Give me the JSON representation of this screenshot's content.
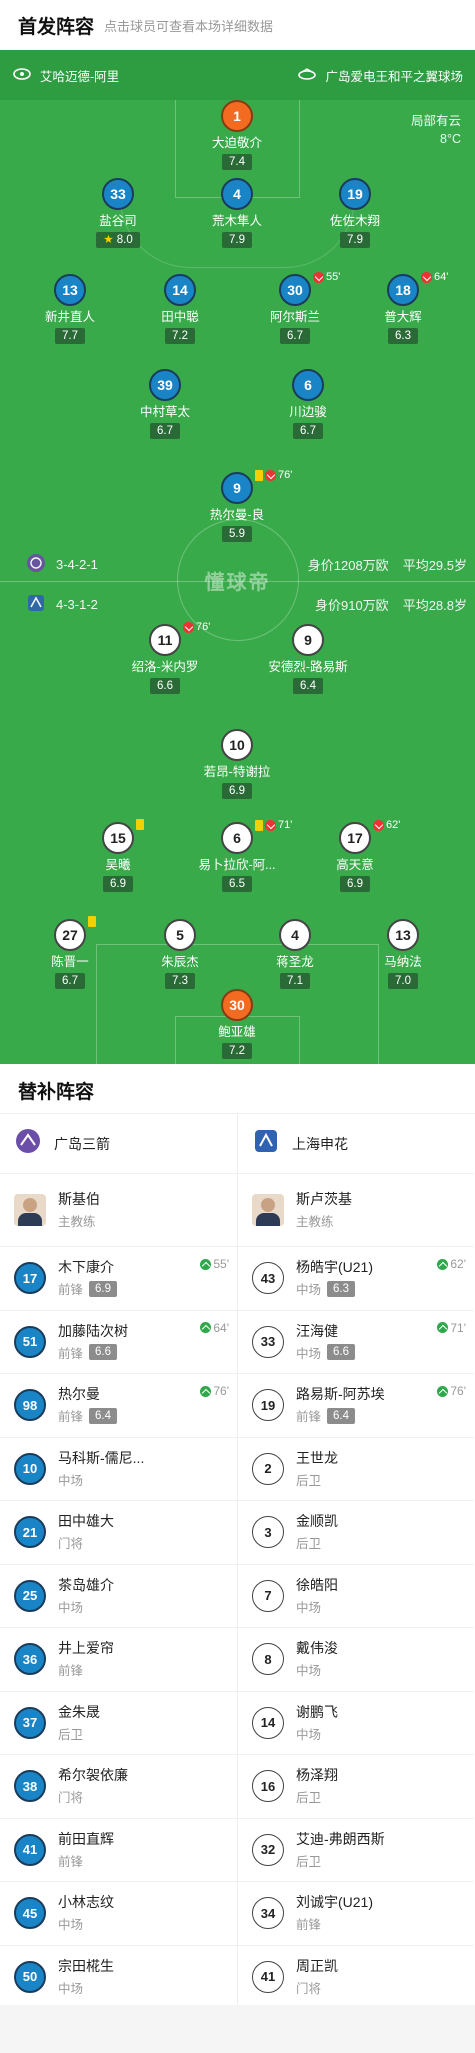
{
  "header": {
    "title": "首发阵容",
    "subtitle": "点击球员可查看本场详细数据"
  },
  "venue": {
    "city": "艾哈迈德-阿里",
    "stadium": "广岛爱电王和平之翼球场"
  },
  "weather": {
    "condition": "局部有云",
    "temp": "8°C"
  },
  "brand": "懂球帝",
  "home_team": {
    "formation": "3-4-2-1",
    "value": "身价1208万欧",
    "age": "平均29.5岁"
  },
  "away_team": {
    "formation": "4-3-1-2",
    "value": "身价910万欧",
    "age": "平均28.8岁"
  },
  "home_players": [
    {
      "num": "1",
      "name": "大迫敬介",
      "rating": "7.4",
      "kind": "gk"
    },
    {
      "num": "33",
      "name": "盐谷司",
      "rating": "8.0",
      "star": true
    },
    {
      "num": "4",
      "name": "荒木隼人",
      "rating": "7.9",
      "goal": true
    },
    {
      "num": "19",
      "name": "佐佐木翔",
      "rating": "7.9",
      "captain": true
    },
    {
      "num": "13",
      "name": "新井直人",
      "rating": "7.7",
      "assist": true
    },
    {
      "num": "14",
      "name": "田中聪",
      "rating": "7.2"
    },
    {
      "num": "30",
      "name": "阿尔斯兰",
      "rating": "6.7",
      "sub_min": "55'"
    },
    {
      "num": "18",
      "name": "普大辉",
      "rating": "6.3",
      "sub_min": "64'"
    },
    {
      "num": "39",
      "name": "中村草太",
      "rating": "6.7"
    },
    {
      "num": "6",
      "name": "川边骏",
      "rating": "6.7"
    },
    {
      "num": "9",
      "name": "热尔曼-良",
      "rating": "5.9",
      "yellow": true,
      "sub_min": "76'"
    }
  ],
  "away_players": [
    {
      "num": "11",
      "name": "绍洛-米内罗",
      "rating": "6.6",
      "sub_min": "76'"
    },
    {
      "num": "9",
      "name": "安德烈-路易斯",
      "rating": "6.4"
    },
    {
      "num": "10",
      "name": "若昂-特谢拉",
      "rating": "6.9"
    },
    {
      "num": "15",
      "name": "吴曦",
      "rating": "6.9",
      "yellow": true,
      "captain": true
    },
    {
      "num": "6",
      "name": "易卜拉欣-阿...",
      "rating": "6.5",
      "yellow": true,
      "sub_min": "71'"
    },
    {
      "num": "17",
      "name": "高天意",
      "rating": "6.9",
      "sub_min": "62'"
    },
    {
      "num": "27",
      "name": "陈晋一",
      "rating": "6.7",
      "yellow": true
    },
    {
      "num": "5",
      "name": "朱辰杰",
      "rating": "7.3"
    },
    {
      "num": "4",
      "name": "蒋圣龙",
      "rating": "7.1"
    },
    {
      "num": "13",
      "name": "马纳法",
      "rating": "7.0"
    },
    {
      "num": "30",
      "name": "鲍亚雄",
      "rating": "7.2",
      "kind": "gk"
    }
  ],
  "subs_section": {
    "title": "替补阵容"
  },
  "home_bench": {
    "team": "广岛三箭",
    "coach": {
      "name": "斯基伯",
      "role": "主教练"
    },
    "players": [
      {
        "num": "17",
        "name": "木下康介",
        "pos": "前锋",
        "rating": "6.9",
        "sub_min": "55'"
      },
      {
        "num": "51",
        "name": "加藤陆次树",
        "pos": "前锋",
        "rating": "6.6",
        "sub_min": "64'"
      },
      {
        "num": "98",
        "name": "热尔曼",
        "pos": "前锋",
        "rating": "6.4",
        "sub_min": "76'"
      },
      {
        "num": "10",
        "name": "马科斯-儒尼...",
        "pos": "中场"
      },
      {
        "num": "21",
        "name": "田中雄大",
        "pos": "门将"
      },
      {
        "num": "25",
        "name": "茶岛雄介",
        "pos": "中场"
      },
      {
        "num": "36",
        "name": "井上爱帘",
        "pos": "前锋"
      },
      {
        "num": "37",
        "name": "金朱晟",
        "pos": "后卫"
      },
      {
        "num": "38",
        "name": "希尔袈依廉",
        "pos": "门将"
      },
      {
        "num": "41",
        "name": "前田直辉",
        "pos": "前锋"
      },
      {
        "num": "45",
        "name": "小林志纹",
        "pos": "中场"
      },
      {
        "num": "50",
        "name": "宗田椛生",
        "pos": "中场"
      }
    ]
  },
  "away_bench": {
    "team": "上海申花",
    "coach": {
      "name": "斯卢茨基",
      "role": "主教练"
    },
    "players": [
      {
        "num": "43",
        "name": "杨皓宇(U21)",
        "pos": "中场",
        "rating": "6.3",
        "sub_min": "62'"
      },
      {
        "num": "33",
        "name": "汪海健",
        "pos": "中场",
        "rating": "6.6",
        "sub_min": "71'"
      },
      {
        "num": "19",
        "name": "路易斯-阿苏埃",
        "pos": "前锋",
        "rating": "6.4",
        "sub_min": "76'"
      },
      {
        "num": "2",
        "name": "王世龙",
        "pos": "后卫"
      },
      {
        "num": "3",
        "name": "金顺凯",
        "pos": "后卫"
      },
      {
        "num": "7",
        "name": "徐皓阳",
        "pos": "中场"
      },
      {
        "num": "8",
        "name": "戴伟浚",
        "pos": "中场"
      },
      {
        "num": "14",
        "name": "谢鹏飞",
        "pos": "中场"
      },
      {
        "num": "16",
        "name": "杨泽翔",
        "pos": "后卫"
      },
      {
        "num": "32",
        "name": "艾迪-弗朗西斯",
        "pos": "后卫"
      },
      {
        "num": "34",
        "name": "刘诚宇(U21)",
        "pos": "前锋"
      },
      {
        "num": "41",
        "name": "周正凯",
        "pos": "门将"
      }
    ]
  }
}
